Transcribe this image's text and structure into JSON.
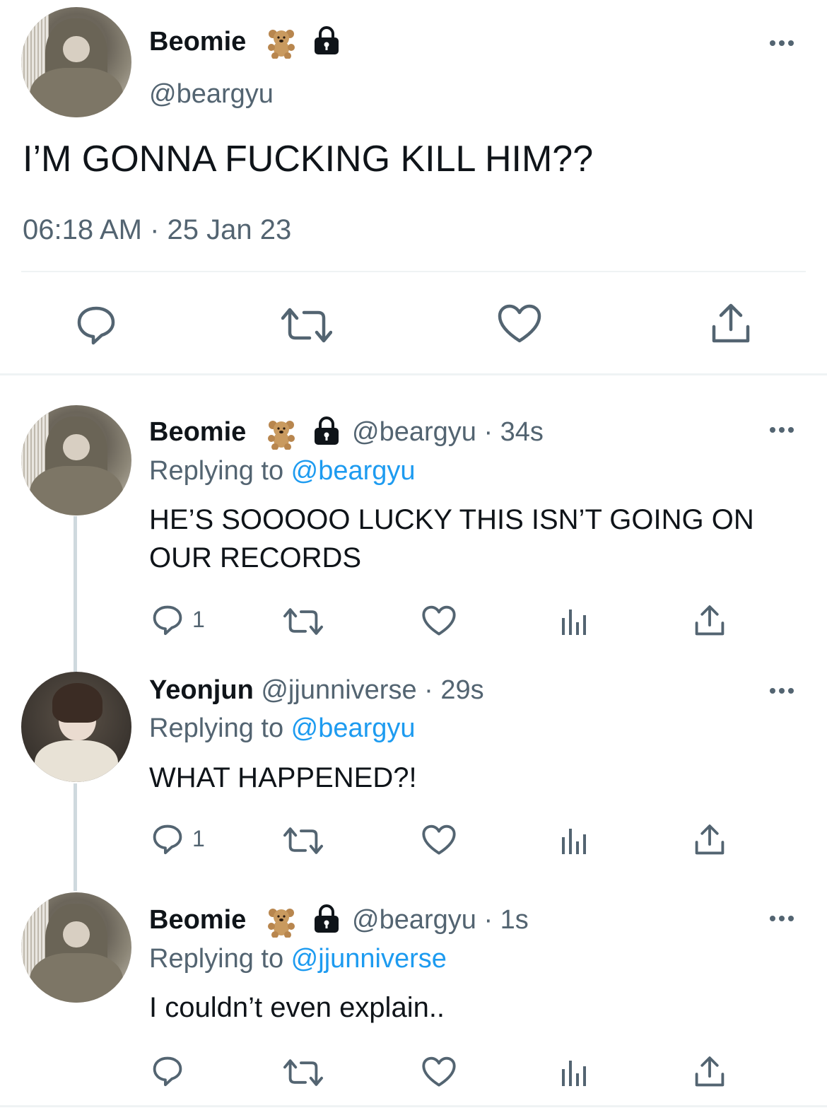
{
  "main_tweet": {
    "display_name": "Beomie",
    "handle": "@beargyu",
    "text": "I’M GONNA FUCKING KILL HIM??",
    "timestamp": "06:18 AM · 25 Jan 23",
    "icons": [
      "teddy-bear-emoji",
      "lock-icon",
      "more-icon",
      "reply-icon",
      "retweet-icon",
      "like-icon",
      "share-icon"
    ]
  },
  "replies": [
    {
      "display_name": "Beomie",
      "meta": "@beargyu · 34s",
      "replying_prefix": "Replying to ",
      "replying_to": "@beargyu",
      "text_line1": "HE’S SOOOOO LUCKY THIS ISN’T GOING ON",
      "text_line2": "OUR RECORDS",
      "reply_count": "1"
    },
    {
      "display_name": "Yeonjun",
      "meta": "@jjunniverse · 29s",
      "replying_prefix": "Replying to ",
      "replying_to": "@beargyu",
      "text_line1": "WHAT HAPPENED?!",
      "reply_count": "1"
    },
    {
      "display_name": "Beomie",
      "meta": "@beargyu · 1s",
      "replying_prefix": "Replying to ",
      "replying_to": "@jjunniverse",
      "text_line1": "I couldn’t even explain.."
    }
  ],
  "colors": {
    "text": "#0f1419",
    "secondary": "#536471",
    "link": "#1d9bf0",
    "divider": "#eff3f4"
  }
}
